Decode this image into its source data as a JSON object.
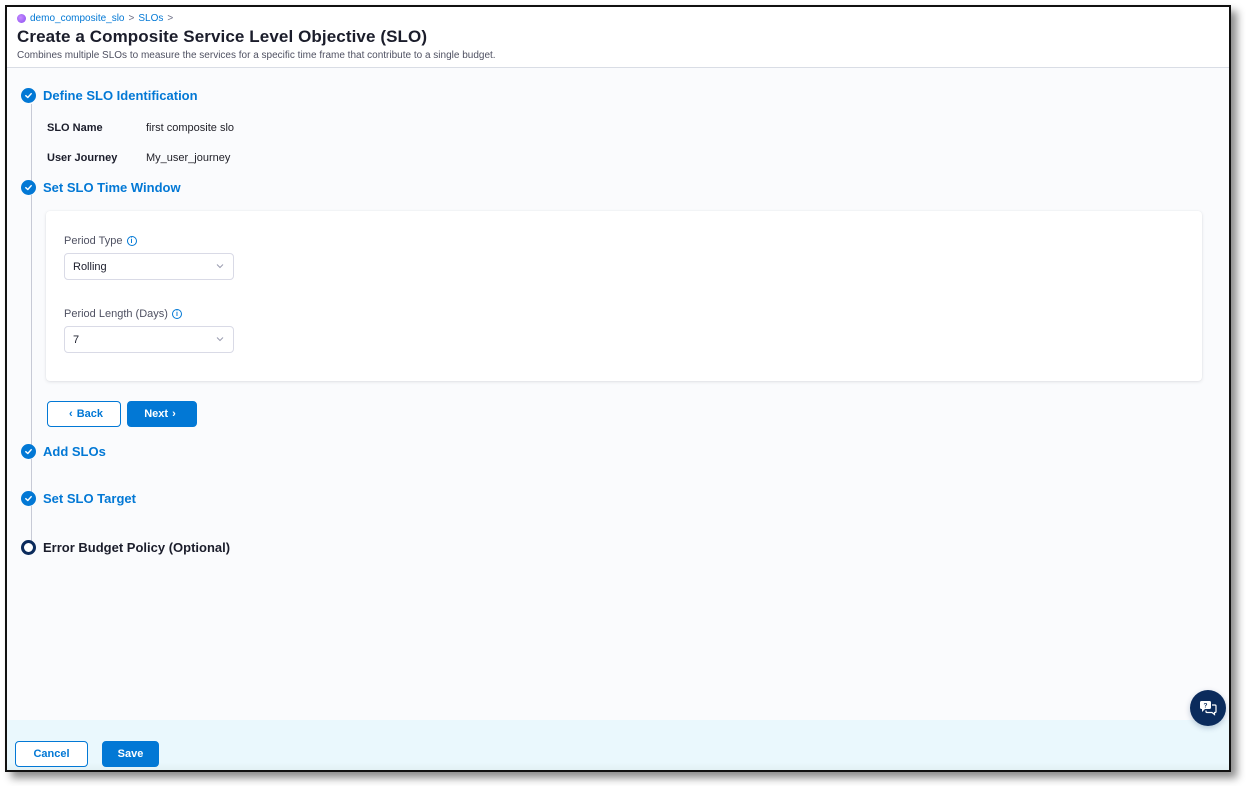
{
  "header": {
    "breadcrumb": [
      {
        "label": "demo_composite_slo",
        "icon": "project-icon"
      },
      {
        "label": "SLOs"
      }
    ],
    "breadcrumb_separator": ">",
    "title": "Create a Composite Service Level Objective (SLO)",
    "subtitle": "Combines multiple SLOs to measure the services for a specific time frame that contribute to a single budget."
  },
  "steps": [
    {
      "title": "Define SLO Identification",
      "status": "completed"
    },
    {
      "title": "Set SLO Time Window",
      "status": "completed"
    },
    {
      "title": "Add SLOs",
      "status": "completed"
    },
    {
      "title": "Set SLO Target",
      "status": "completed"
    },
    {
      "title": "Error Budget Policy (Optional)",
      "status": "current"
    }
  ],
  "identification_summary": [
    {
      "key": "SLO Name",
      "value": "first composite slo"
    },
    {
      "key": "User Journey",
      "value": "My_user_journey"
    }
  ],
  "time_window": {
    "period_type": {
      "label": "Period Type",
      "value": "Rolling",
      "info_icon": "info-icon"
    },
    "period_length": {
      "label": "Period Length (Days)",
      "value": "7",
      "info_icon": "info-icon"
    }
  },
  "step_nav": {
    "back_label": "Back",
    "next_label": "Next",
    "back_arrow": "‹",
    "next_arrow": "›"
  },
  "footer": {
    "cancel_label": "Cancel",
    "save_label": "Save"
  },
  "help": {
    "icon": "chat-help-icon"
  },
  "colors": {
    "accent": "#0278d5",
    "current_step": "#0b2b5c",
    "footer_bg": "#eaf8fd",
    "page_bg": "#fafbfd"
  }
}
